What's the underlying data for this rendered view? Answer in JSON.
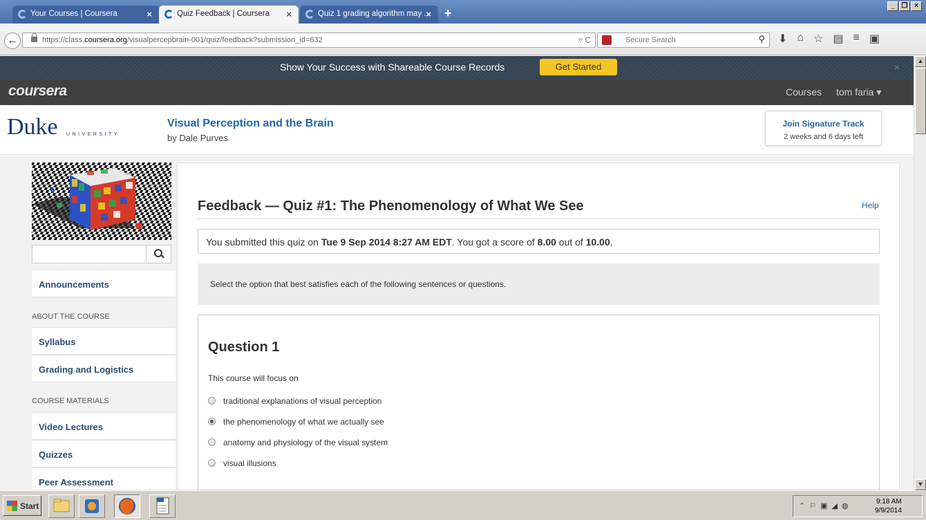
{
  "browser": {
    "tabs": [
      {
        "label": "Your Courses | Coursera",
        "active": false
      },
      {
        "label": "Quiz Feedback | Coursera",
        "active": true
      },
      {
        "label": "Quiz 1 grading algorithm may ...",
        "active": false
      }
    ],
    "url_prefix": "https://class.",
    "url_domain": "coursera.org",
    "url_path": "/visualpercepbrain-001/quiz/feedback?submission_id=632",
    "search_placeholder": "Secure Search"
  },
  "promo": {
    "text": "Show Your Success with Shareable Course Records",
    "button": "Get Started",
    "close": "×"
  },
  "topnav": {
    "logo": "coursera",
    "courses": "Courses",
    "user": "tom faria ▾"
  },
  "header": {
    "university": "Duke",
    "university_sub": "UNIVERSITY",
    "course_title": "Visual Perception and the Brain",
    "instructor": "by Dale Purves",
    "signature": {
      "title": "Join Signature Track",
      "subtitle": "2 weeks and 6 days left"
    }
  },
  "sidebar": {
    "items": [
      {
        "label": "Announcements"
      },
      {
        "label": "Syllabus"
      },
      {
        "label": "Grading and Logistics"
      },
      {
        "label": "Video Lectures"
      },
      {
        "label": "Quizzes"
      },
      {
        "label": "Peer Assessment"
      }
    ],
    "sections": [
      "ABOUT THE COURSE",
      "COURSE MATERIALS"
    ]
  },
  "main": {
    "title": "Feedback — Quiz #1: The Phenomenology of What We See",
    "help": "Help",
    "score": {
      "prefix": "You submitted this quiz on ",
      "date": "Tue 9 Sep 2014 8:27 AM EDT",
      "mid": ". You got a score of ",
      "got": "8.00",
      "outof": " out of ",
      "total": "10.00",
      "end": "."
    },
    "instructions": "Select the option that best satisfies each of the following sentences or questions.",
    "question": {
      "title": "Question 1",
      "text": "This course will focus on",
      "options": [
        {
          "label": "traditional explanations of visual perception",
          "checked": false
        },
        {
          "label": "the phenomenology of what we actually see",
          "checked": true
        },
        {
          "label": "anatomy and physiology of the visual system",
          "checked": false
        },
        {
          "label": "visual illusions",
          "checked": false
        }
      ]
    }
  },
  "taskbar": {
    "start": "Start",
    "time": "9:18 AM",
    "date": "9/9/2014"
  }
}
